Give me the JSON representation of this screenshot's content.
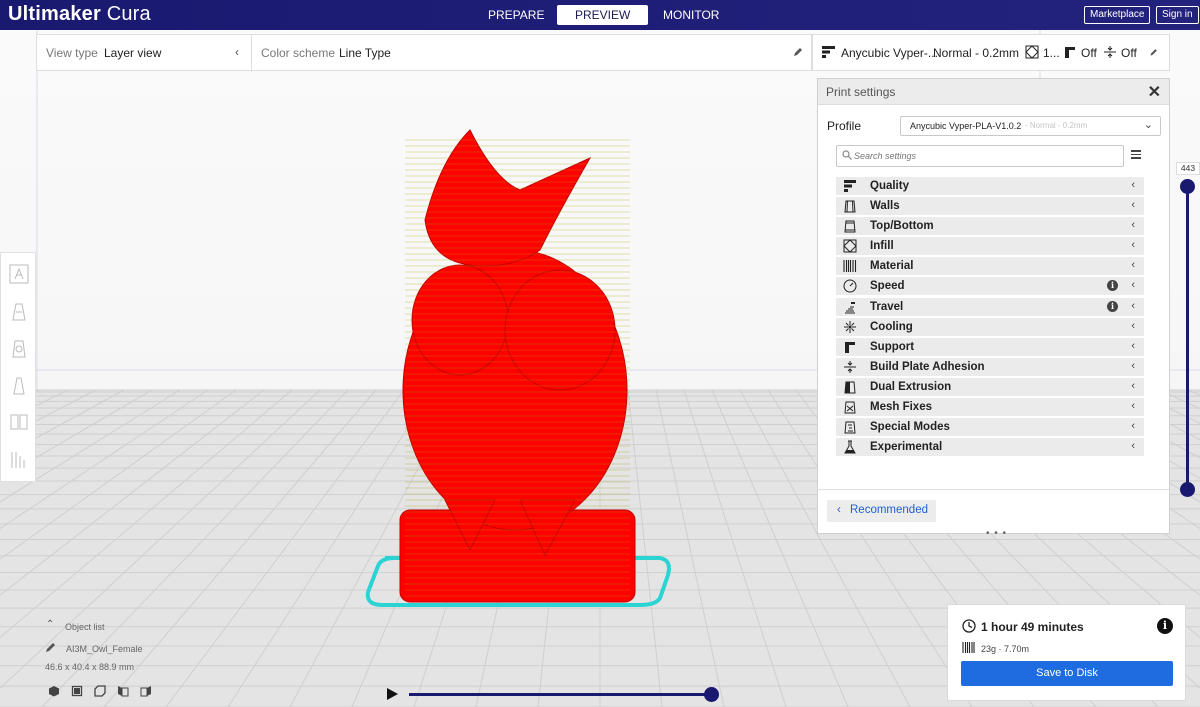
{
  "app": {
    "title_bold": "Ultimaker",
    "title_light": "Cura"
  },
  "stages": [
    {
      "label": "PREPARE",
      "active": false
    },
    {
      "label": "PREVIEW",
      "active": true
    },
    {
      "label": "MONITOR",
      "active": false
    }
  ],
  "header_buttons": {
    "marketplace": "Marketplace",
    "sign_in": "Sign in"
  },
  "view_options": {
    "view_type_label": "View type",
    "view_type_value": "Layer view",
    "color_scheme_label": "Color scheme",
    "color_scheme_value": "Line Type"
  },
  "printer_bar": {
    "printer": "Anycubic Vyper-...",
    "profile": "Normal - 0.2mm",
    "infill": "1...",
    "support": "Off",
    "adhesion": "Off"
  },
  "print_settings": {
    "title": "Print settings",
    "profile_label": "Profile",
    "profile_name": "Anycubic Vyper-PLA-V1.0.2",
    "profile_sub": "- Normal - 0.2mm",
    "search_placeholder": "Search settings",
    "categories": [
      {
        "label": "Quality",
        "icon": "quality-icon",
        "info": false
      },
      {
        "label": "Walls",
        "icon": "walls-icon",
        "info": false
      },
      {
        "label": "Top/Bottom",
        "icon": "top-bottom-icon",
        "info": false
      },
      {
        "label": "Infill",
        "icon": "infill-icon",
        "info": false
      },
      {
        "label": "Material",
        "icon": "material-icon",
        "info": false
      },
      {
        "label": "Speed",
        "icon": "speed-icon",
        "info": true
      },
      {
        "label": "Travel",
        "icon": "travel-icon",
        "info": true
      },
      {
        "label": "Cooling",
        "icon": "cooling-icon",
        "info": false
      },
      {
        "label": "Support",
        "icon": "support-icon",
        "info": false
      },
      {
        "label": "Build Plate Adhesion",
        "icon": "adhesion-icon",
        "info": false
      },
      {
        "label": "Dual Extrusion",
        "icon": "dual-extrusion-icon",
        "info": false
      },
      {
        "label": "Mesh Fixes",
        "icon": "mesh-fixes-icon",
        "info": false
      },
      {
        "label": "Special Modes",
        "icon": "special-modes-icon",
        "info": false
      },
      {
        "label": "Experimental",
        "icon": "experimental-icon",
        "info": false
      }
    ],
    "recommended_label": "Recommended"
  },
  "layer_slider": {
    "value": "443"
  },
  "object_list": {
    "toggle_label": "Object list",
    "object_name": "AI3M_Owl_Female",
    "dimensions": "46.6 x 40.4 x 88.9 mm"
  },
  "estimate": {
    "time": "1 hour 49 minutes",
    "material": "23g · 7.70m",
    "save_label": "Save to Disk"
  },
  "colors": {
    "header": "#191970",
    "accent": "#1f6ce0",
    "model": "#ff0000",
    "skirt": "#2bd3d3"
  }
}
